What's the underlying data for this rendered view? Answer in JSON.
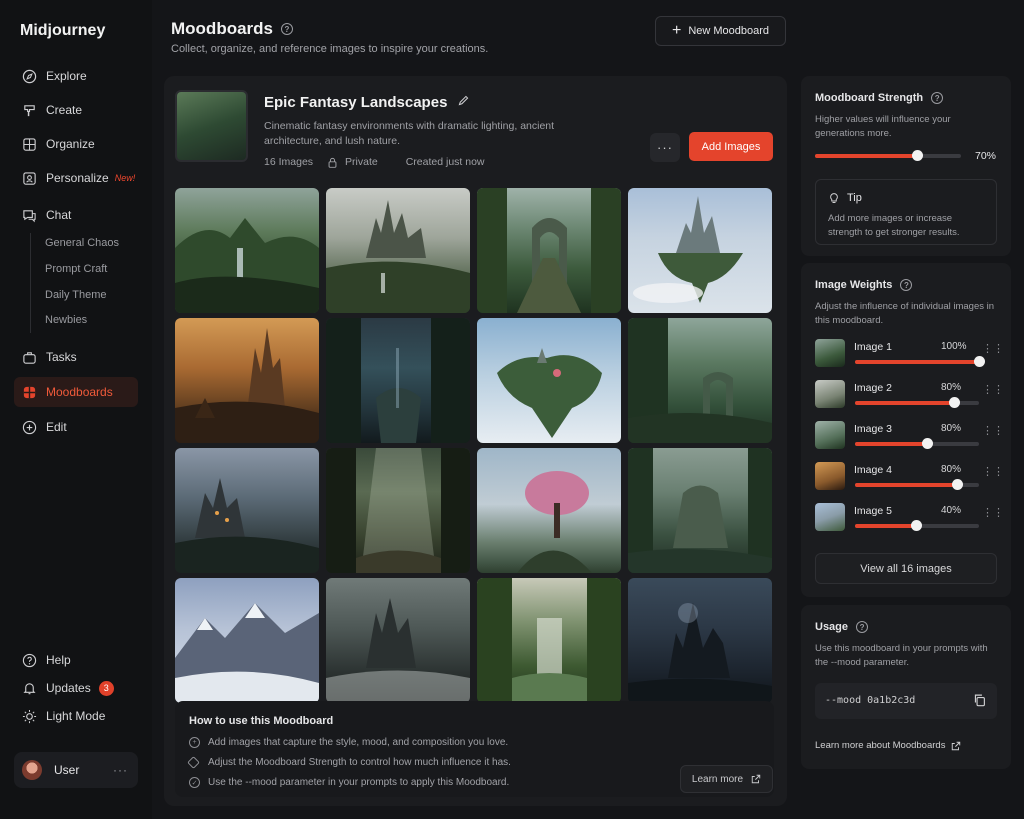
{
  "app": {
    "name": "Midjourney"
  },
  "nav": {
    "items": [
      {
        "label": "Explore",
        "icon": "compass-icon"
      },
      {
        "label": "Create",
        "icon": "brush-icon"
      },
      {
        "label": "Organize",
        "icon": "grid-icon"
      },
      {
        "label": "Personalize",
        "icon": "personalize-icon",
        "tag": "New!"
      },
      {
        "label": "Chat",
        "icon": "chat-icon"
      },
      {
        "label": "Tasks",
        "icon": "tasks-icon"
      },
      {
        "label": "Moodboards",
        "icon": "moodboard-icon",
        "active": true
      },
      {
        "label": "Edit",
        "icon": "edit-icon"
      }
    ],
    "chat_channels": [
      "General Chaos",
      "Prompt Craft",
      "Daily Theme",
      "Newbies"
    ],
    "bottom": [
      {
        "label": "Help",
        "icon": "help-icon"
      },
      {
        "label": "Updates",
        "icon": "bell-icon",
        "badge": "3"
      },
      {
        "label": "Light Mode",
        "icon": "sun-icon"
      }
    ],
    "user": {
      "name": "User",
      "more": "···"
    }
  },
  "header": {
    "title": "Moodboards",
    "subtitle": "Collect, organize, and reference images to inspire your creations.",
    "new_button": "New Moodboard"
  },
  "moodboard": {
    "title": "Epic Fantasy Landscapes",
    "description": "Cinematic fantasy environments with dramatic lighting, ancient architecture, and lush nature.",
    "image_count": "16 Images",
    "privacy": "Private",
    "created": "Created just now",
    "more_label": "···",
    "add_button": "Add Images"
  },
  "howto": {
    "title": "How to use this Moodboard",
    "items": [
      "Add images that capture the style, mood, and composition you love.",
      "Adjust the Moodboard Strength to control how much influence it has.",
      "Use the --mood parameter in your prompts to apply this Moodboard."
    ],
    "learn_button": "Learn more"
  },
  "strength": {
    "title": "Moodboard Strength",
    "subtitle": "Higher values will influence your generations more.",
    "value": 70,
    "value_label": "70%",
    "tip_title": "Tip",
    "tip_text": "Add more images or increase strength to get stronger results."
  },
  "weights": {
    "title": "Image Weights",
    "subtitle": "Adjust the influence of individual images in this moodboard.",
    "items": [
      {
        "name": "Image 1",
        "pct": "100%",
        "value": 100
      },
      {
        "name": "Image 2",
        "pct": "80%",
        "value": 80
      },
      {
        "name": "Image 3",
        "pct": "80%",
        "value": 58
      },
      {
        "name": "Image 4",
        "pct": "80%",
        "value": 82
      },
      {
        "name": "Image 5",
        "pct": "40%",
        "value": 49
      }
    ],
    "view_all": "View all 16 images"
  },
  "usage": {
    "title": "Usage",
    "subtitle": "Use this moodboard in your prompts with the --mood parameter.",
    "code": "--mood 0a1b2c3d",
    "learn_link": "Learn more about Moodboards"
  },
  "colors": {
    "accent": "#e4442c",
    "background": "#141518",
    "panel": "#1b1c1f"
  }
}
